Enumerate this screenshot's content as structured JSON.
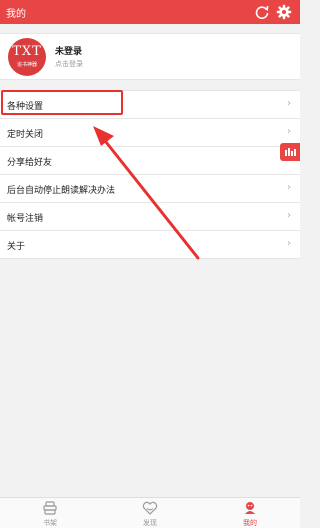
{
  "header": {
    "title": "我的"
  },
  "profile": {
    "logo_text": "TXT",
    "logo_subtext": "追书神器",
    "name": "未登录",
    "subtitle": "点击登录"
  },
  "menu": [
    {
      "label": "各种设置"
    },
    {
      "label": "定时关闭"
    },
    {
      "label": "分享给好友"
    },
    {
      "label": "后台自动停止朗读解决办法"
    },
    {
      "label": "帐号注销"
    },
    {
      "label": "关于"
    }
  ],
  "chevron": "›",
  "tabs": [
    {
      "label": "书架",
      "icon": "bookshelf-icon"
    },
    {
      "label": "发现",
      "icon": "discover-icon"
    },
    {
      "label": "我的",
      "icon": "profile-icon",
      "active": true
    }
  ],
  "colors": {
    "accent": "#e84545",
    "annotation": "#e8322f"
  }
}
